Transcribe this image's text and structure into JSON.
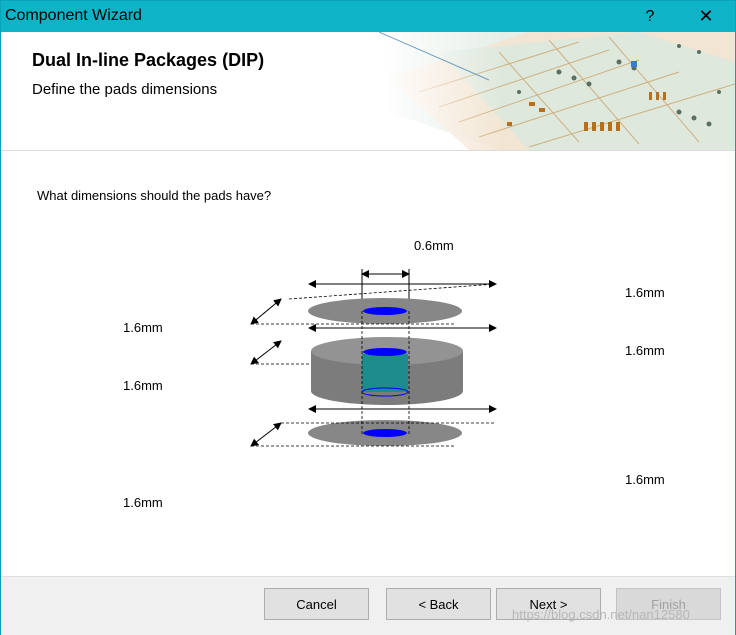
{
  "window": {
    "title": "Component Wizard",
    "help_glyph": "?",
    "close_glyph": "✕"
  },
  "header": {
    "title": "Dual In-line Packages (DIP)",
    "subtitle": "Define the pads dimensions"
  },
  "content": {
    "question": "What dimensions should the pads have?",
    "dimensions": {
      "hole_diameter": "0.6mm",
      "top_pad_x": "1.6mm",
      "top_pad_y": "1.6mm",
      "inner_pad_x": "1.6mm",
      "inner_pad_y": "1.6mm",
      "bottom_pad_x": "1.6mm",
      "bottom_pad_y": "1.6mm"
    }
  },
  "buttons": {
    "cancel": "Cancel",
    "back": "< Back",
    "next": "Next >",
    "finish": "Finish"
  },
  "colors": {
    "titlebar": "#0fb3c6",
    "pad": "#878787",
    "hole": "#0000ff",
    "barrel": "#1e8c8c"
  },
  "watermark": "https://blog.csdn.net/nan12580"
}
